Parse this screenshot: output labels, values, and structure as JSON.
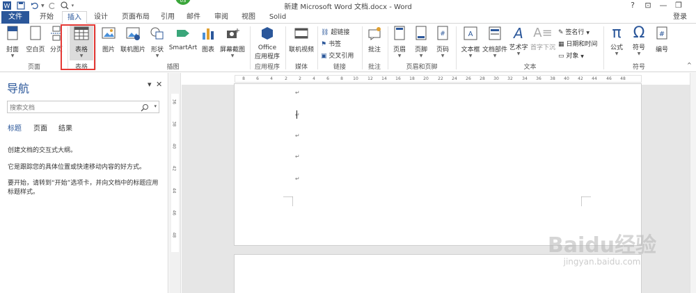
{
  "title_bar": {
    "title": "新建 Microsoft Word 文档.docx - Word",
    "badge": "03",
    "help": "?",
    "ribbon_display": "⊡",
    "minimize": "—",
    "restore": "❐"
  },
  "tabs": [
    "文件",
    "开始",
    "插入",
    "设计",
    "页面布局",
    "引用",
    "邮件",
    "审阅",
    "视图",
    "Solid"
  ],
  "login": "登录",
  "ribbon": {
    "pages": {
      "cover": "封面",
      "blank": "空白页",
      "break": "分页",
      "label": "页面"
    },
    "tables": {
      "table": "表格",
      "label": "表格"
    },
    "illustrations": {
      "picture": "图片",
      "online_picture": "联机图片",
      "shapes": "形状",
      "smartart": "SmartArt",
      "chart": "图表",
      "screenshot": "屏幕截图",
      "label": "插图"
    },
    "apps": {
      "office": "Office",
      "office2": "应用程序",
      "label": "应用程序"
    },
    "media": {
      "online_video": "联机视频",
      "label": "媒体"
    },
    "links": {
      "hyperlink": "超链接",
      "bookmark": "书签",
      "crossref": "交叉引用",
      "label": "链接"
    },
    "comments": {
      "comment": "批注",
      "label": "批注"
    },
    "header_footer": {
      "header": "页眉",
      "footer": "页脚",
      "page_number": "页码",
      "label": "页眉和页脚"
    },
    "text": {
      "textbox": "文本框",
      "quickparts": "文档部件",
      "wordart": "艺术字",
      "dropcap": "首字下沉",
      "signature": "签名行",
      "datetime": "日期和时间",
      "object": "对象",
      "label": "文本"
    },
    "symbols": {
      "equation": "公式",
      "symbol": "符号",
      "number": "编号",
      "label": "符号"
    }
  },
  "nav": {
    "title": "导航",
    "search_placeholder": "搜索文档",
    "tabs": [
      "标题",
      "页面",
      "结果"
    ],
    "text1": "创建文档的交互式大纲。",
    "text2": "它是跟踪您的具体位置或快速移动内容的好方式。",
    "text3": "要开始，请转到“开始”选项卡，并向文档中的标题应用标题样式。"
  },
  "ruler": {
    "h_ticks": [
      "8",
      "6",
      "4",
      "2",
      "2",
      "4",
      "6",
      "8",
      "10",
      "12",
      "14",
      "16",
      "18",
      "20",
      "22",
      "24",
      "26",
      "28",
      "30",
      "32",
      "34",
      "36",
      "38",
      "40",
      "42",
      "44",
      "46",
      "48"
    ],
    "v_ticks": [
      "36",
      "38",
      "40",
      "42",
      "44",
      "46",
      "48"
    ],
    "tab_marker": "L"
  },
  "document": {
    "paragraph_mark": "↵"
  },
  "watermark": {
    "line1": "Baidu经验",
    "line2": "jingyan.baidu.com"
  },
  "colors": {
    "accent": "#2b579a",
    "highlight": "#e53935",
    "badge": "#3aa63a"
  }
}
